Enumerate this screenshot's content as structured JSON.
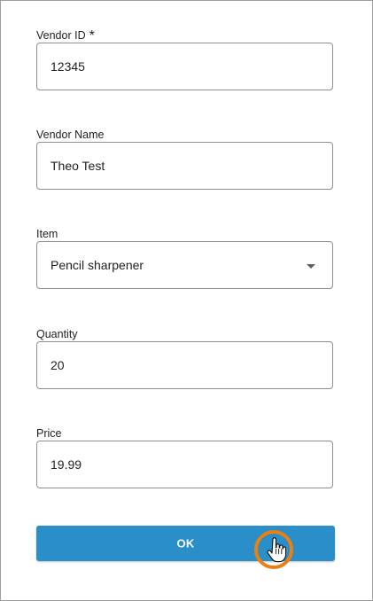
{
  "form": {
    "vendor_id": {
      "label": "Vendor ID",
      "required_marker": "*",
      "value": "12345"
    },
    "vendor_name": {
      "label": "Vendor Name",
      "value": "Theo Test"
    },
    "item": {
      "label": "Item",
      "value": "Pencil sharpener",
      "icon": "chevron-down-icon"
    },
    "quantity": {
      "label": "Quantity",
      "value": "20"
    },
    "price": {
      "label": "Price",
      "value": "19.99"
    }
  },
  "actions": {
    "ok_label": "OK",
    "button_color": "#2a8ec9"
  },
  "overlay": {
    "click_indicator_color": "#ea7f12",
    "cursor_icon": "hand-pointer-icon"
  }
}
